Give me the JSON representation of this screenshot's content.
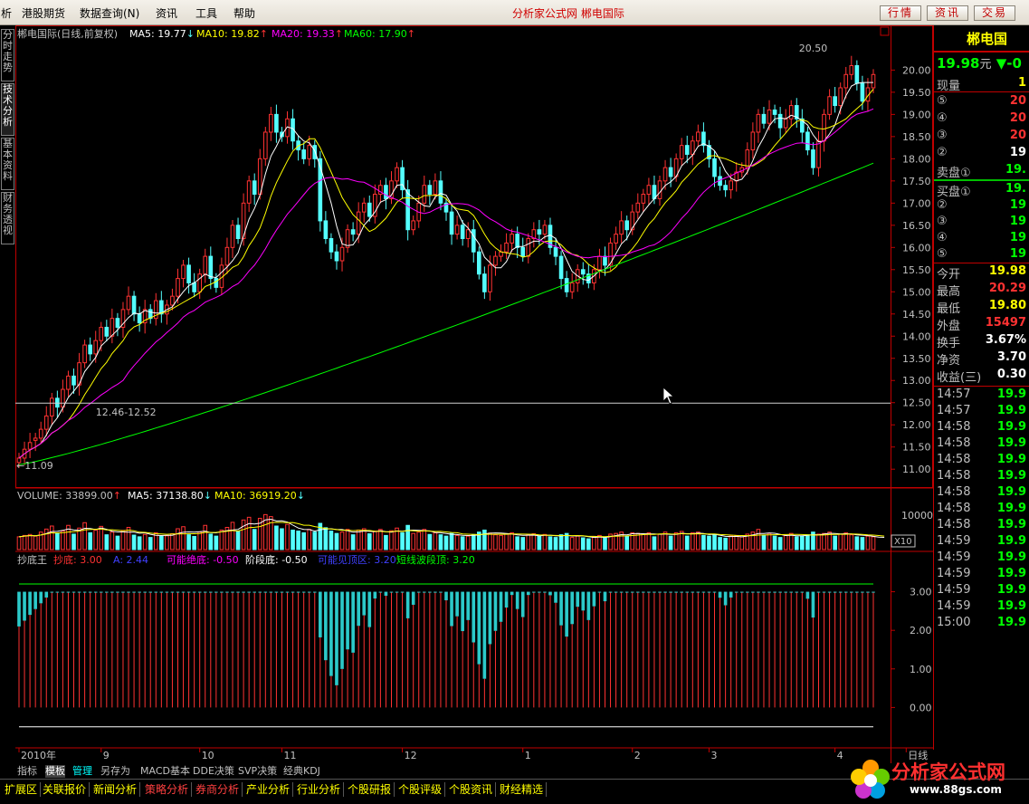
{
  "menu": {
    "items": [
      "析",
      "港股期货",
      "数据查询(N)",
      "资讯",
      "工具",
      "帮助"
    ],
    "center_title": "分析家公式网  郴电国际",
    "buttons": [
      "行情",
      "资讯",
      "交易"
    ]
  },
  "side_tabs": [
    "分时走势",
    "技术分析",
    "基本资料",
    "财务透视"
  ],
  "colors": {
    "up": "#ff3232",
    "down": "#54ffff",
    "ma5": "#ffffff",
    "ma10": "#ffff00",
    "ma20": "#ff00ff",
    "ma60": "#00ff00",
    "frame": "#c00000"
  },
  "price_panel": {
    "title": "郴电国际(日线,前复权)",
    "ma_labels": [
      {
        "text": "MA5: 19.77",
        "arrow": "↓",
        "color": "#ffffff"
      },
      {
        "text": "MA10: 19.82",
        "arrow": "↑",
        "color": "#ffff00"
      },
      {
        "text": "MA20: 19.33",
        "arrow": "↑",
        "color": "#ff00ff"
      },
      {
        "text": "MA60: 17.90",
        "arrow": "↑",
        "color": "#00ff00"
      }
    ],
    "high_label": "20.50",
    "low_label": "11.09",
    "hline_label": "12.46-12.52",
    "hline_value": 12.49,
    "ylim": [
      10.8,
      20.6
    ],
    "ticks": [
      "20.00",
      "19.50",
      "19.00",
      "18.50",
      "18.00",
      "17.50",
      "17.00",
      "16.50",
      "16.00",
      "15.50",
      "15.00",
      "14.50",
      "14.00",
      "13.50",
      "13.00",
      "12.50",
      "12.00",
      "11.50",
      "11.00"
    ]
  },
  "volume_panel": {
    "label": "VOLUME: 33899.00",
    "ma5": "MA5: 37138.80",
    "ma10": "MA10: 36919.20",
    "tick": "10000",
    "unit": "X10",
    "ylim": [
      0,
      14000
    ]
  },
  "indicator_panel": {
    "name": "抄底王",
    "items": [
      {
        "text": "抄底: 3.00",
        "color": "#ff3232"
      },
      {
        "text": "A: 2.44",
        "color": "#4040ff"
      },
      {
        "text": "可能绝底: -0.50",
        "color": "#ff00ff"
      },
      {
        "text": "阶段底: -0.50",
        "color": "#ffffff"
      },
      {
        "text": "可能见顶区: 3.20",
        "color": "#4040ff"
      },
      {
        "text": "短线波段顶: 3.20",
        "color": "#00ff00"
      }
    ],
    "ticks": [
      "3.00",
      "2.00",
      "1.00",
      "0.00"
    ],
    "ylim": [
      -1.0,
      3.6
    ]
  },
  "x_axis": {
    "labels": [
      {
        "text": "2010年",
        "index": 0
      },
      {
        "text": "9",
        "index": 15
      },
      {
        "text": "10",
        "index": 33
      },
      {
        "text": "11",
        "index": 48
      },
      {
        "text": "12",
        "index": 70
      },
      {
        "text": "1",
        "index": 92
      },
      {
        "text": "2",
        "index": 112
      },
      {
        "text": "3",
        "index": 126
      },
      {
        "text": "4",
        "index": 149
      },
      {
        "text": "日线",
        "index": 162
      }
    ]
  },
  "bottom_tabs": [
    "指标",
    "模板",
    "管理",
    "另存为",
    "MACD基本",
    "DDE决策",
    "SVP决策",
    "经典KDJ"
  ],
  "status_bar": [
    "扩展区",
    "关联报价",
    "新闻分析",
    "策略分析",
    "券商分析",
    "产业分析",
    "行业分析",
    "个股研报",
    "个股评级",
    "个股资讯",
    "财经精选"
  ],
  "quote": {
    "name": "郴电国",
    "price": "19.98",
    "price_unit": "元",
    "change": "▼-0",
    "xianliang_label": "现量",
    "xianliang": "1",
    "sell": [
      {
        "label": "⑤",
        "value": "20"
      },
      {
        "label": "④",
        "value": "20"
      },
      {
        "label": "③",
        "value": "20"
      },
      {
        "label": "②",
        "value": "19"
      },
      {
        "label": "卖盘①",
        "value": "19."
      }
    ],
    "buy": [
      {
        "label": "买盘①",
        "value": "19."
      },
      {
        "label": "②",
        "value": "19"
      },
      {
        "label": "③",
        "value": "19"
      },
      {
        "label": "④",
        "value": "19"
      },
      {
        "label": "⑤",
        "value": "19"
      }
    ],
    "stats": [
      {
        "label": "今开",
        "value": "19.98",
        "color": "#ffff00"
      },
      {
        "label": "最高",
        "value": "20.29",
        "color": "#ff3232"
      },
      {
        "label": "最低",
        "value": "19.80",
        "color": "#ffff00"
      },
      {
        "label": "外盘",
        "value": "15497",
        "color": "#ff3232"
      },
      {
        "label": "换手",
        "value": "3.67%",
        "color": "#ffffff"
      },
      {
        "label": "净资",
        "value": "3.70",
        "color": "#ffffff"
      },
      {
        "label": "收益(三)",
        "value": "0.30",
        "color": "#ffffff"
      }
    ],
    "ticks": [
      {
        "time": "14:57",
        "value": "19.9"
      },
      {
        "time": "14:57",
        "value": "19.9"
      },
      {
        "time": "14:58",
        "value": "19.9"
      },
      {
        "time": "14:58",
        "value": "19.9"
      },
      {
        "time": "14:58",
        "value": "19.9"
      },
      {
        "time": "14:58",
        "value": "19.9"
      },
      {
        "time": "14:58",
        "value": "19.9"
      },
      {
        "time": "14:58",
        "value": "19.9"
      },
      {
        "time": "14:58",
        "value": "19.9"
      },
      {
        "time": "14:59",
        "value": "19.9"
      },
      {
        "time": "14:59",
        "value": "19.9"
      },
      {
        "time": "14:59",
        "value": "19.9"
      },
      {
        "time": "14:59",
        "value": "19.9"
      },
      {
        "time": "14:59",
        "value": "19.9"
      },
      {
        "time": "15:00",
        "value": "19.9"
      }
    ]
  },
  "watermark": {
    "text": "分析家公式网",
    "url": "www.88gs.com"
  },
  "chart_data": {
    "type": "candlestick",
    "close": [
      11.25,
      11.45,
      11.6,
      11.7,
      11.9,
      12.2,
      12.6,
      12.4,
      12.8,
      13.1,
      12.9,
      13.4,
      13.8,
      13.6,
      13.9,
      14.2,
      14.0,
      14.4,
      14.2,
      14.6,
      14.9,
      14.5,
      14.3,
      14.6,
      14.4,
      14.8,
      14.5,
      14.7,
      14.9,
      15.3,
      15.6,
      15.2,
      15.0,
      15.4,
      15.8,
      15.3,
      15.1,
      15.6,
      16.0,
      16.5,
      16.2,
      17.0,
      17.5,
      17.2,
      18.0,
      18.6,
      19.0,
      18.6,
      18.5,
      18.9,
      18.4,
      18.2,
      18.0,
      18.3,
      18.0,
      16.6,
      16.2,
      15.9,
      15.7,
      16.0,
      16.4,
      16.3,
      16.8,
      17.0,
      16.7,
      17.2,
      17.4,
      17.1,
      17.5,
      17.8,
      17.3,
      16.4,
      16.6,
      17.0,
      17.4,
      17.2,
      17.5,
      17.0,
      16.8,
      16.3,
      16.5,
      16.2,
      16.4,
      15.9,
      15.4,
      15.0,
      15.6,
      15.8,
      15.9,
      16.1,
      16.3,
      16.0,
      15.8,
      16.2,
      16.4,
      16.3,
      16.5,
      16.0,
      15.8,
      15.3,
      15.0,
      15.2,
      15.5,
      15.4,
      15.2,
      15.5,
      15.8,
      15.6,
      16.1,
      16.3,
      16.6,
      16.4,
      16.8,
      17.0,
      17.2,
      17.4,
      17.1,
      17.5,
      17.8,
      17.6,
      18.0,
      18.3,
      18.1,
      18.4,
      18.6,
      18.3,
      18.0,
      17.6,
      17.4,
      17.3,
      17.5,
      17.7,
      17.8,
      18.2,
      18.6,
      19.0,
      18.8,
      19.1,
      19.0,
      18.7,
      18.9,
      19.2,
      18.9,
      18.6,
      18.2,
      17.8,
      18.4,
      19.0,
      19.4,
      19.2,
      19.6,
      19.9,
      20.1,
      19.7,
      19.3,
      19.6,
      19.9
    ],
    "open": [
      11.15,
      11.25,
      11.45,
      11.65,
      11.7,
      11.9,
      12.2,
      12.6,
      12.4,
      12.8,
      13.1,
      12.9,
      13.4,
      13.8,
      13.6,
      13.9,
      14.2,
      14.0,
      14.4,
      14.2,
      14.6,
      14.9,
      14.5,
      14.3,
      14.6,
      14.4,
      14.8,
      14.5,
      14.7,
      14.9,
      15.3,
      15.6,
      15.2,
      15.0,
      15.4,
      15.8,
      15.3,
      15.1,
      15.6,
      16.0,
      16.5,
      16.2,
      17.0,
      17.5,
      17.2,
      18.0,
      18.6,
      19.0,
      18.6,
      18.5,
      18.9,
      18.4,
      18.2,
      18.0,
      18.3,
      18.0,
      16.6,
      16.2,
      15.9,
      15.7,
      16.0,
      16.4,
      16.3,
      16.8,
      17.0,
      16.7,
      17.2,
      17.4,
      17.1,
      17.5,
      17.8,
      17.3,
      16.4,
      16.6,
      17.0,
      17.4,
      17.2,
      17.5,
      17.0,
      16.8,
      16.3,
      16.5,
      16.2,
      16.4,
      15.9,
      15.4,
      15.0,
      15.6,
      15.8,
      15.9,
      16.1,
      16.3,
      16.0,
      15.8,
      16.2,
      16.4,
      16.3,
      16.5,
      16.0,
      15.8,
      15.3,
      15.0,
      15.2,
      15.5,
      15.4,
      15.2,
      15.5,
      15.8,
      15.6,
      16.1,
      16.3,
      16.6,
      16.4,
      16.8,
      17.0,
      17.2,
      17.4,
      17.1,
      17.5,
      17.8,
      17.6,
      18.0,
      18.3,
      18.1,
      18.4,
      18.6,
      18.3,
      18.0,
      17.6,
      17.4,
      17.3,
      17.5,
      17.7,
      17.8,
      18.2,
      18.6,
      19.0,
      18.8,
      19.1,
      19.0,
      18.7,
      18.9,
      19.2,
      18.9,
      18.6,
      18.2,
      17.8,
      18.4,
      19.0,
      19.4,
      19.2,
      19.6,
      19.9,
      20.1,
      19.7,
      19.3,
      19.6
    ],
    "ma60_anchor": [
      11.1,
      17.9
    ],
    "volume": [
      38000,
      42000,
      45000,
      40000,
      52000,
      61000,
      70000,
      48000,
      55000,
      72000,
      46000,
      64000,
      80000,
      50000,
      58000,
      69000,
      44000,
      52000,
      40000,
      57000,
      66000,
      43000,
      38000,
      45000,
      36000,
      50000,
      39000,
      41000,
      47000,
      62000,
      68000,
      44000,
      39000,
      52000,
      72000,
      46000,
      40000,
      58000,
      66000,
      81000,
      55000,
      88000,
      96000,
      60000,
      93000,
      104000,
      98000,
      70000,
      62000,
      75000,
      58000,
      55000,
      50000,
      60000,
      52000,
      78000,
      65000,
      55000,
      48000,
      52000,
      60000,
      44000,
      58000,
      62000,
      47000,
      55000,
      60000,
      42000,
      56000,
      64000,
      50000,
      72000,
      48000,
      52000,
      60000,
      45000,
      50000,
      44000,
      40000,
      48000,
      42000,
      38000,
      40000,
      45000,
      52000,
      58000,
      49000,
      44000,
      42000,
      46000,
      50000,
      38000,
      36000,
      44000,
      47000,
      40000,
      45000,
      38000,
      36000,
      44000,
      48000,
      36000,
      40000,
      35000,
      32000,
      38000,
      42000,
      34000,
      46000,
      48000,
      52000,
      40000,
      50000,
      48000,
      46000,
      50000,
      38000,
      46000,
      52000,
      40000,
      50000,
      54000,
      40000,
      50000,
      52000,
      42000,
      40000,
      44000,
      36000,
      34000,
      40000,
      42000,
      38000,
      46000,
      52000,
      60000,
      42000,
      48000,
      40000,
      36000,
      42000,
      48000,
      38000,
      40000,
      44000,
      52000,
      46000,
      48000,
      52000,
      40000,
      46000,
      50000,
      44000,
      38000,
      36000,
      40000,
      38000,
      34000,
      33899
    ]
  }
}
